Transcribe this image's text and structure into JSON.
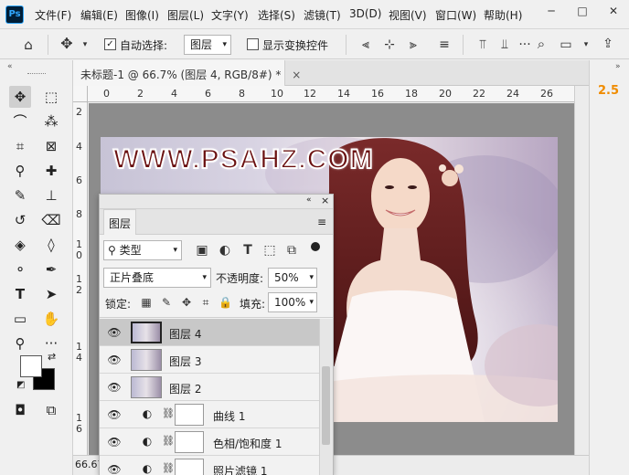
{
  "app": {
    "logo": "Ps"
  },
  "menu": [
    "文件(F)",
    "编辑(E)",
    "图像(I)",
    "图层(L)",
    "文字(Y)",
    "选择(S)",
    "滤镜(T)",
    "3D(D)",
    "视图(V)",
    "窗口(W)",
    "帮助(H)"
  ],
  "window_controls": {
    "minimize": "─",
    "maximize": "□",
    "close": "✕"
  },
  "options": {
    "auto_select_label": "自动选择:",
    "auto_select_target": "图层",
    "show_transform_label": "显示变换控件"
  },
  "right_panel": {
    "value": "2.5"
  },
  "document": {
    "tab_title": "未标题-1 @ 66.7% (图层 4, RGB/8#) *",
    "zoom": "66.67",
    "ruler_top": [
      "0",
      "2",
      "4",
      "6",
      "8",
      "10",
      "12",
      "14",
      "16",
      "18",
      "20",
      "22",
      "24",
      "26"
    ],
    "ruler_left": [
      "2",
      "4",
      "6",
      "8",
      "1\n0",
      "1\n2",
      "1\n4",
      "1\n6"
    ],
    "watermark": "WWW.PSAHZ.COM"
  },
  "layers_panel": {
    "tab_label": "图层",
    "filter_kind": "类型",
    "blend_mode": "正片叠底",
    "opacity_label": "不透明度:",
    "opacity_value": "50%",
    "lock_label": "锁定:",
    "fill_label": "填充:",
    "fill_value": "100%",
    "layers": [
      {
        "name": "图层 4",
        "kind": "pixel",
        "selected": true
      },
      {
        "name": "图层 3",
        "kind": "pixel",
        "selected": false
      },
      {
        "name": "图层 2",
        "kind": "pixel",
        "selected": false
      },
      {
        "name": "曲线 1",
        "kind": "adjustment",
        "selected": false
      },
      {
        "name": "色相/饱和度 1",
        "kind": "adjustment",
        "selected": false
      },
      {
        "name": "照片滤镜 1",
        "kind": "adjustment",
        "selected": false
      }
    ]
  },
  "colors": {
    "accent_orange": "#f08c00",
    "ps_logo_bg": "#001e36",
    "ps_logo_fg": "#31a8ff",
    "selection_row": "#c8c8c8"
  }
}
